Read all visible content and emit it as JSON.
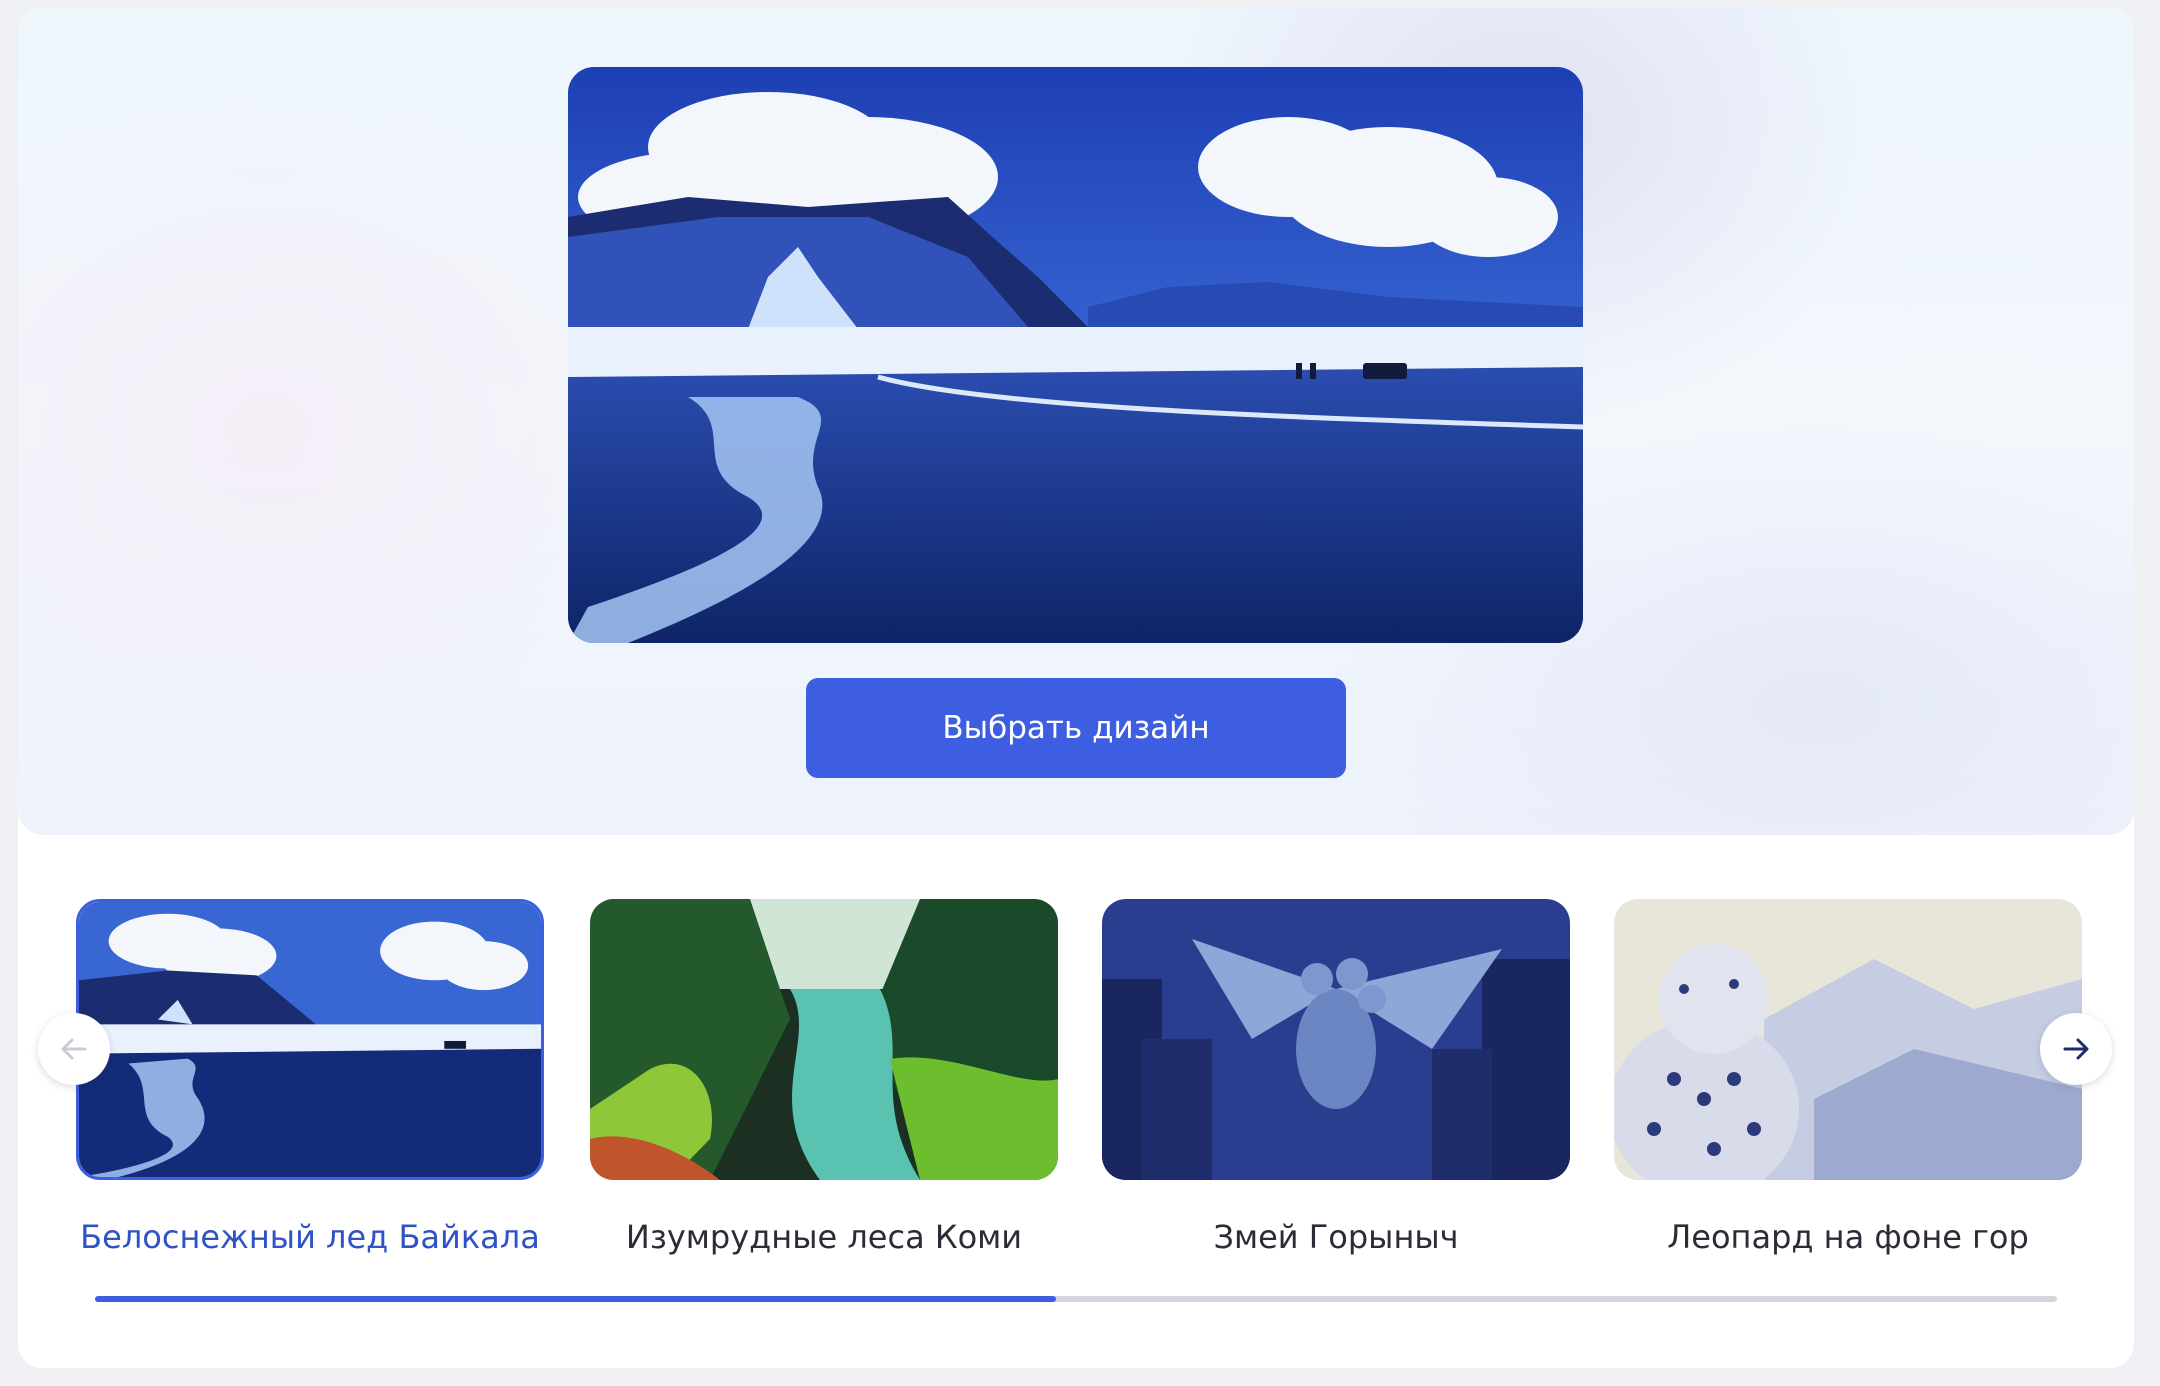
{
  "hero": {
    "image_icon": "baikal-ice-illustration",
    "choose_button_label": "Выбрать дизайн"
  },
  "carousel": {
    "items": [
      {
        "label": "Белоснежный лед Байкала",
        "image_icon": "baikal-ice-illustration",
        "selected": true
      },
      {
        "label": "Изумрудные леса Коми",
        "image_icon": "komi-forest-illustration",
        "selected": false
      },
      {
        "label": "Змей Горыныч",
        "image_icon": "dragon-illustration",
        "selected": false
      },
      {
        "label": "Леопард на фоне гор",
        "image_icon": "leopard-illustration",
        "selected": false
      }
    ],
    "prev_icon": "arrow-left-icon",
    "next_icon": "arrow-right-icon",
    "progress": 0.49
  },
  "colors": {
    "accent": "#3d5ee1",
    "selected_label": "#2f52c4",
    "text": "#2a2d35",
    "track": "#d3d6dd"
  }
}
